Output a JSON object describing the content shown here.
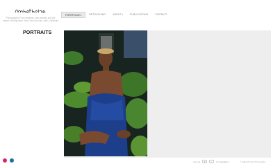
{
  "brand": {
    "logo_text": "NyEyeTheFire",
    "tagline": "Photographic Fine creatively, lace identity, and the nature of being seen. New York and San Jose, California"
  },
  "nav": {
    "items": [
      {
        "label": "PORTFOLIO",
        "active": true,
        "has_dropdown": true
      },
      {
        "label": "RETOUCHING",
        "active": false,
        "has_dropdown": false
      },
      {
        "label": "ABOUT",
        "active": false,
        "has_dropdown": true
      },
      {
        "label": "PUBLICATIONS",
        "active": false,
        "has_dropdown": false
      },
      {
        "label": "CONTACT",
        "active": false,
        "has_dropdown": false
      }
    ]
  },
  "page": {
    "section_title": "PORTRAITS"
  },
  "social": [
    {
      "icon": "instagram-icon",
      "color": "#d6246e"
    },
    {
      "icon": "linkedin-icon",
      "color": "#1f6ca6"
    }
  ],
  "footer": {
    "view_label": "view as",
    "view_value": "▾",
    "nav_label": "for navigation",
    "copyright": "© NyEyeTheFire Photography"
  },
  "colors": {
    "gallery_background": "#eeeeee",
    "active_nav": "#e9e9e9"
  }
}
